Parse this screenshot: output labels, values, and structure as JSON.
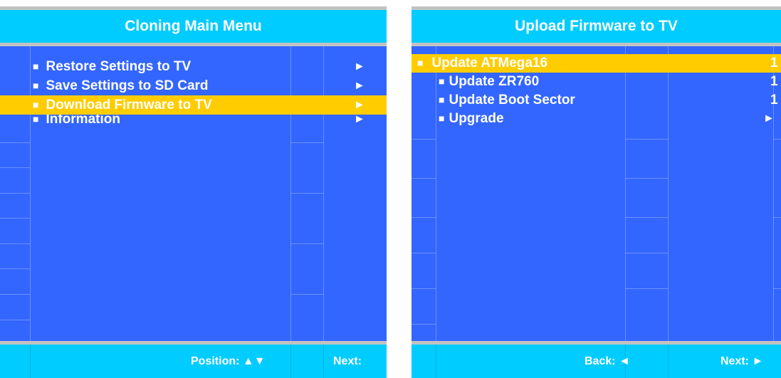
{
  "left_panel": {
    "title": "Cloning Main Menu",
    "bullet": "■",
    "items": [
      {
        "label": "Restore Settings to TV",
        "arrow": "►",
        "selected": false
      },
      {
        "label": "Save Settings to SD Card",
        "arrow": "►",
        "selected": false
      },
      {
        "label": "Download Firmware to TV",
        "arrow": "►",
        "selected": true
      },
      {
        "label": "Information",
        "arrow": "►",
        "selected": false
      }
    ],
    "footer": {
      "position_label": "Position: ▲▼",
      "next_label": "Next:"
    }
  },
  "right_panel": {
    "title": "Upload Firmware to TV",
    "bullet": "■",
    "items": [
      {
        "label": "Update ATMega16",
        "value": "1",
        "selected": true
      },
      {
        "label": "Update ZR760",
        "value": "1",
        "selected": false
      },
      {
        "label": "Update Boot Sector",
        "value": "1",
        "selected": false
      },
      {
        "label": "Upgrade",
        "arrow": "►",
        "selected": false
      }
    ],
    "footer": {
      "back_label": "Back: ◄",
      "next_label": "Next: ►"
    }
  },
  "colors": {
    "header_cyan": "#00ccff",
    "body_blue": "#3366ff",
    "highlight_yellow": "#ffcc00",
    "separator_gray": "#c2c2c2",
    "text": "#ffffff"
  },
  "icons": {
    "bullet": "square-bullet-icon",
    "arrow_right": "right-arrow-icon",
    "arrow_left": "left-arrow-icon",
    "arrow_up_down": "up-down-arrow-icon"
  }
}
